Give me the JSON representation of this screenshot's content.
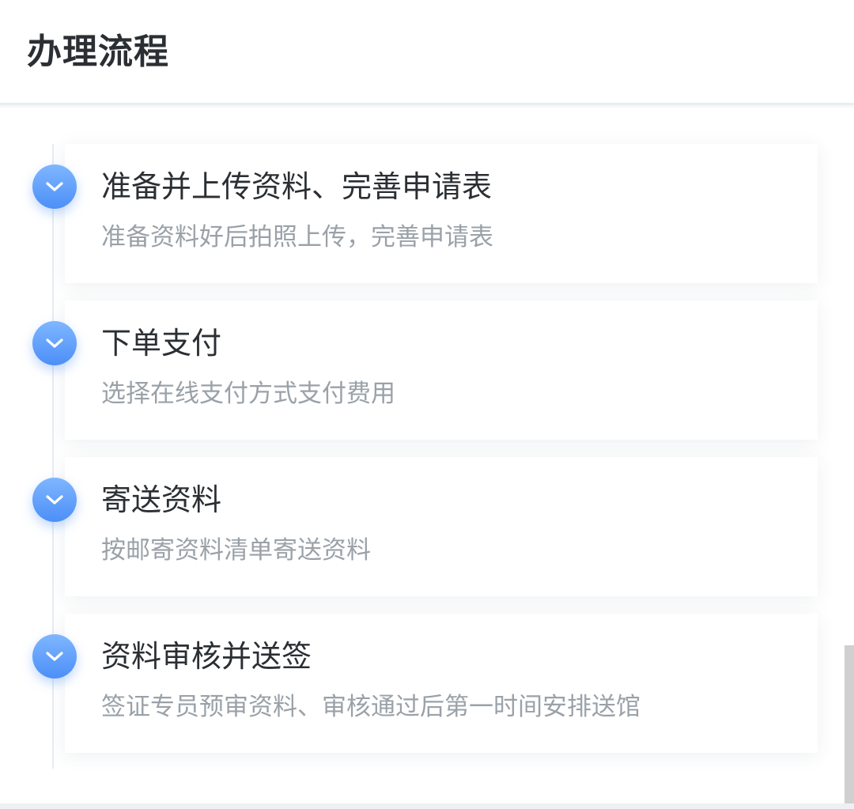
{
  "header": {
    "title": "办理流程"
  },
  "steps": [
    {
      "title": "准备并上传资料、完善申请表",
      "desc": "准备资料好后拍照上传，完善申请表",
      "icon": "chevron-down-icon"
    },
    {
      "title": "下单支付",
      "desc": "选择在线支付方式支付费用",
      "icon": "chevron-down-icon"
    },
    {
      "title": "寄送资料",
      "desc": "按邮寄资料清单寄送资料",
      "icon": "chevron-down-icon"
    },
    {
      "title": "资料审核并送签",
      "desc": "签证专员预审资料、审核通过后第一时间安排送馆",
      "icon": "chevron-down-icon"
    }
  ],
  "colors": {
    "accent": "#4c8ff7",
    "title_text": "#2b2f33",
    "desc_text": "#9aa1a8"
  }
}
